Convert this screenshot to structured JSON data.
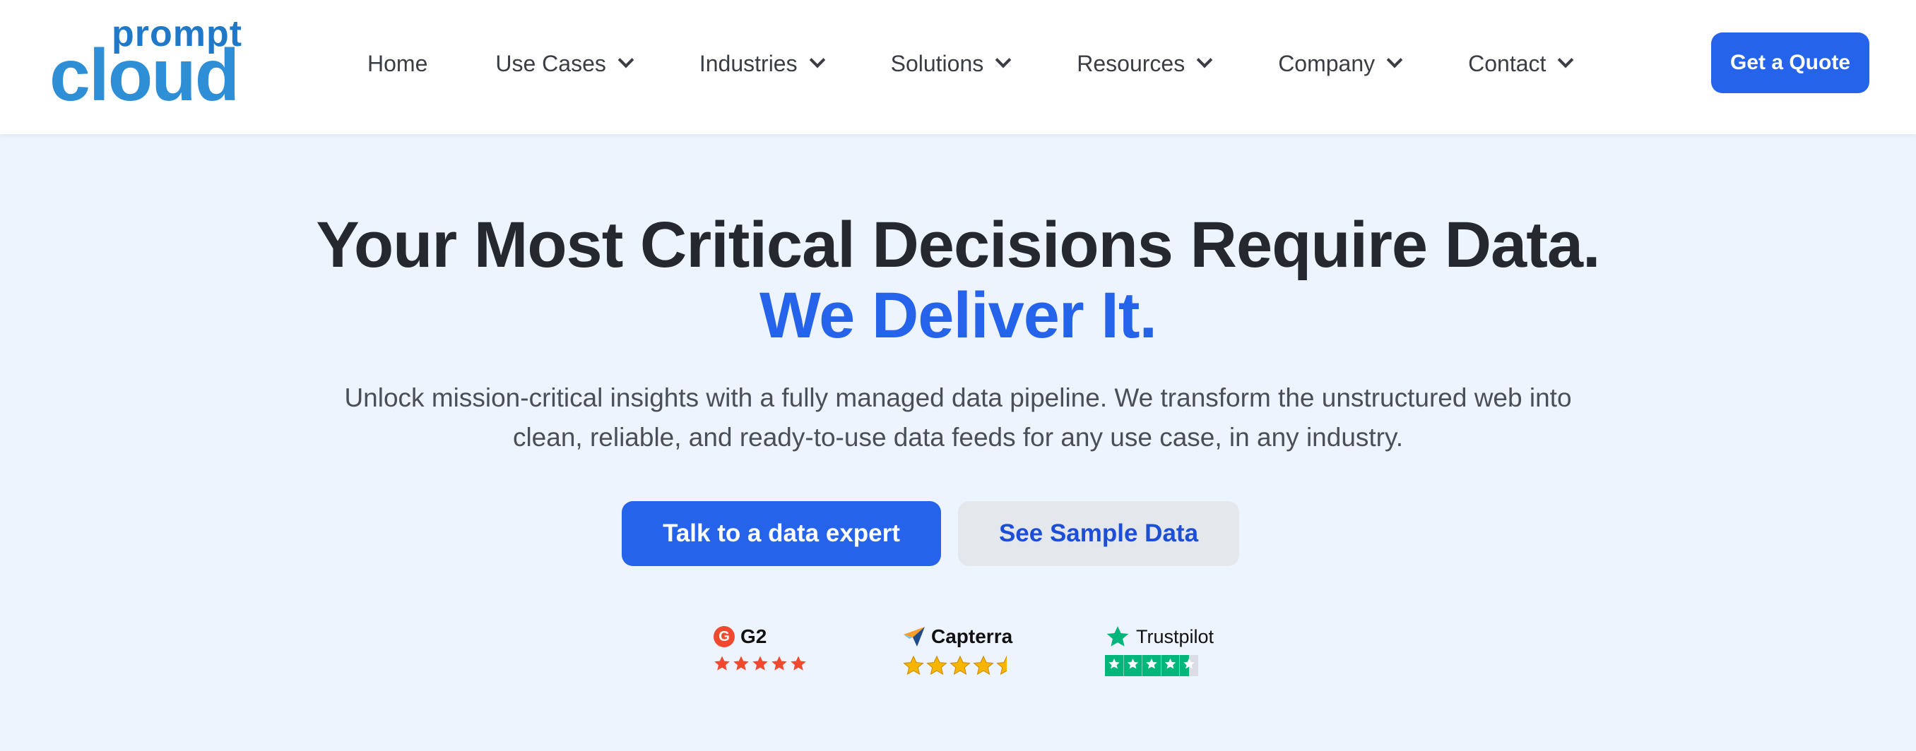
{
  "header": {
    "logo": {
      "top": "prompt",
      "main": "cloud"
    },
    "nav": [
      {
        "label": "Home",
        "has_dropdown": false
      },
      {
        "label": "Use Cases",
        "has_dropdown": true
      },
      {
        "label": "Industries",
        "has_dropdown": true
      },
      {
        "label": "Solutions",
        "has_dropdown": true
      },
      {
        "label": "Resources",
        "has_dropdown": true
      },
      {
        "label": "Company",
        "has_dropdown": true
      },
      {
        "label": "Contact",
        "has_dropdown": true
      }
    ],
    "cta_label": "Get a Quote"
  },
  "hero": {
    "title_line1": "Your Most Critical Decisions Require Data.",
    "title_line2": "We Deliver It.",
    "subtitle_line1": "Unlock mission-critical insights with a fully managed data pipeline. We transform the unstructured web into",
    "subtitle_line2": "clean, reliable, and ready-to-use data feeds for any use case, in any industry.",
    "primary_button": "Talk to a data expert",
    "secondary_button": "See Sample Data"
  },
  "ratings": [
    {
      "brand": "G2",
      "icon": "g2-logo-icon",
      "stars": 5,
      "star_color": "#f0492f"
    },
    {
      "brand": "Capterra",
      "icon": "capterra-logo-icon",
      "stars": 4.5,
      "star_color": "#f7b500"
    },
    {
      "brand": "Trustpilot",
      "icon": "trustpilot-star-icon",
      "stars": 4.5,
      "star_color": "#00b67a"
    }
  ],
  "colors": {
    "accent": "#2563eb",
    "background": "#eef4fd",
    "heading": "#25282e"
  }
}
